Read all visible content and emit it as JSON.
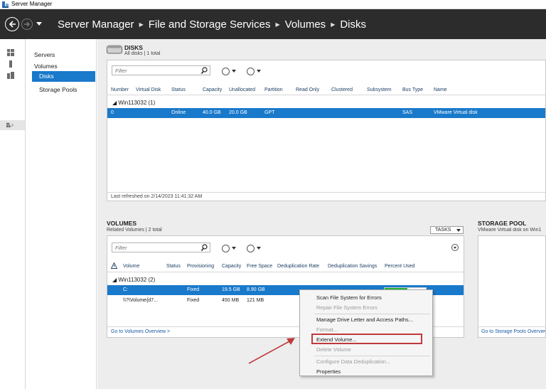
{
  "window": {
    "title": "Server Manager"
  },
  "breadcrumb": [
    "Server Manager",
    "File and Storage Services",
    "Volumes",
    "Disks"
  ],
  "nav": {
    "items": [
      "Servers",
      "Volumes",
      "Disks",
      "Storage Pools"
    ],
    "selected": "Disks"
  },
  "disks": {
    "title": "DISKS",
    "subtitle": "All disks | 1 total",
    "filter_placeholder": "Filter",
    "columns": [
      "Number",
      "Virtual Disk",
      "Status",
      "Capacity",
      "Unallocated",
      "Partition",
      "Read Only",
      "Clustered",
      "Subsystem",
      "Bus Type",
      "Name"
    ],
    "group": "Win113032 (1)",
    "rows": [
      {
        "number": "0",
        "virtual_disk": "",
        "status": "Online",
        "capacity": "40.0 GB",
        "unallocated": "20.0 GB",
        "partition": "GPT",
        "read_only": "",
        "clustered": "",
        "subsystem": "",
        "bus_type": "SAS",
        "name": "VMware Virtual disk"
      }
    ],
    "footer": "Last refreshed on 2/14/2023 11:41:32 AM"
  },
  "volumes": {
    "title": "VOLUMES",
    "subtitle": "Related Volumes | 2 total",
    "tasks_label": "TASKS",
    "filter_placeholder": "Filter",
    "columns": [
      "Volume",
      "Status",
      "Provisioning",
      "Capacity",
      "Free Space",
      "Deduplication Rate",
      "Deduplication Savings",
      "Percent Used"
    ],
    "group": "Win113032 (2)",
    "rows": [
      {
        "volume": "C:",
        "status": "",
        "provisioning": "Fixed",
        "capacity": "19.5 GB",
        "free_space": "8.90 GB",
        "percent_used": 0.55
      },
      {
        "volume": "\\\\?\\Volume{d7...",
        "status": "",
        "provisioning": "Fixed",
        "capacity": "450 MB",
        "free_space": "121 MB",
        "percent_used": null
      }
    ],
    "footer_link": "Go to Volumes Overview >"
  },
  "storage_pool": {
    "title": "STORAGE POOL",
    "subtitle": "VMware Virtual disk on Win1",
    "footer_link": "Go to Storage Pools Overview >"
  },
  "context_menu": {
    "items": [
      {
        "label": "Scan File System for Errors",
        "enabled": true
      },
      {
        "label": "Repair File System Errors",
        "enabled": false
      },
      {
        "label": "Manage Drive Letter and Access Paths...",
        "enabled": true
      },
      {
        "label": "Format...",
        "enabled": false
      },
      {
        "label": "Extend Volume...",
        "enabled": true,
        "highlighted": true
      },
      {
        "label": "Delete Volume",
        "enabled": false
      },
      {
        "label": "Configure Data Deduplication...",
        "enabled": false
      },
      {
        "label": "Properties",
        "enabled": true
      }
    ]
  },
  "colors": {
    "header_bg": "#2c2c2c",
    "selection": "#1979ca",
    "annotation_red": "#c0393b",
    "progress_green": "#1fae32"
  }
}
